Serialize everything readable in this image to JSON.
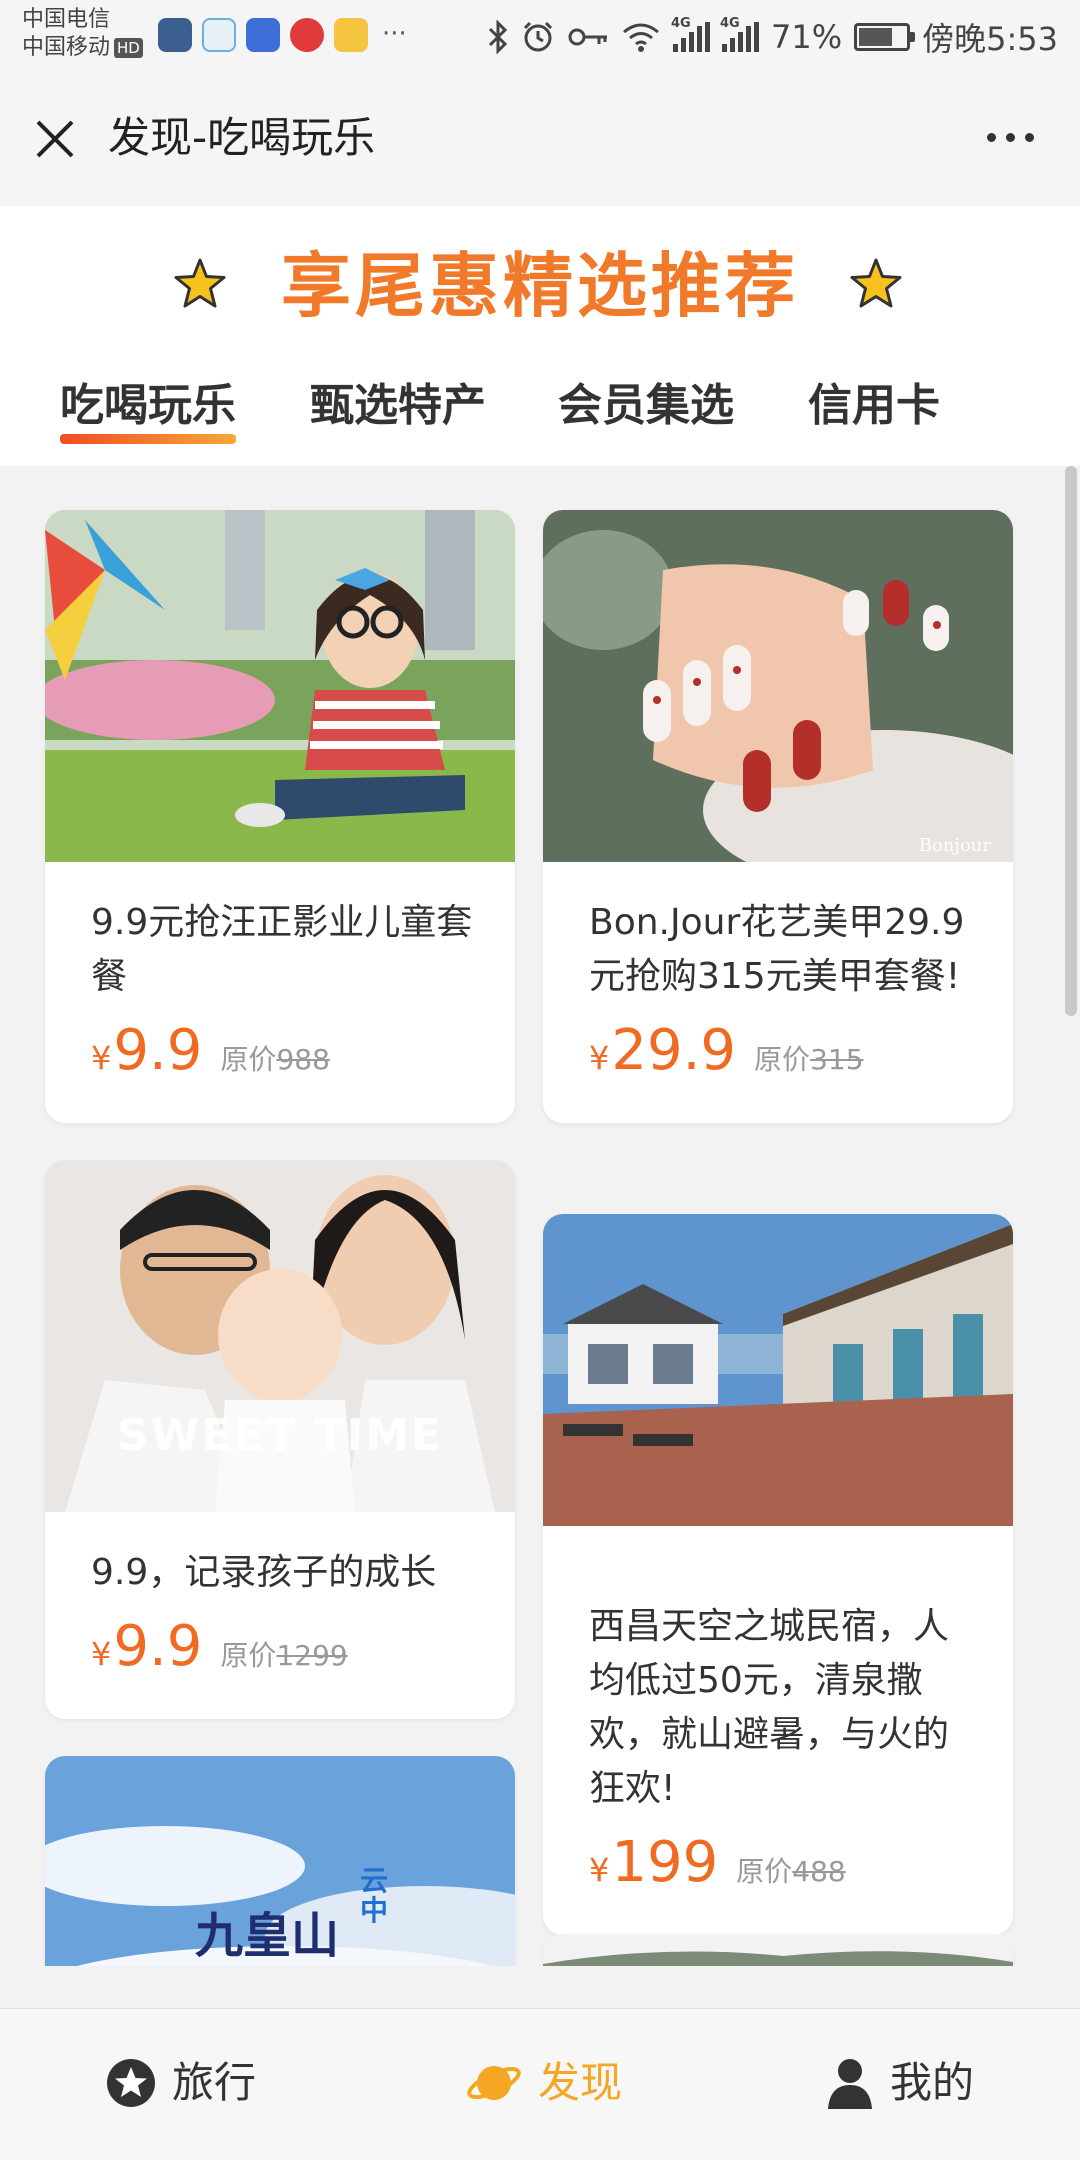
{
  "status_bar": {
    "carrier_1": "中国电信",
    "carrier_2": "中国移动",
    "hd": "HD",
    "more": "···",
    "net_1": "4G",
    "net_2": "4G",
    "battery_pct": "71%",
    "battery_level": 0.71,
    "time": "傍晚5:53"
  },
  "titlebar": {
    "title": "发现-吃喝玩乐"
  },
  "promo": {
    "title": "享尾惠精选推荐"
  },
  "tabs": [
    {
      "label": "吃喝玩乐",
      "active": true
    },
    {
      "label": "甄选特产",
      "active": false
    },
    {
      "label": "会员集选",
      "active": false
    },
    {
      "label": "信用卡",
      "active": false
    }
  ],
  "cards": [
    {
      "title": "9.9元抢汪正影业儿童套餐",
      "currency": "¥",
      "price": "9.9",
      "orig_label": "原价",
      "orig_price": "988"
    },
    {
      "title": "Bon.Jour花艺美甲29.9元抢购315元美甲套餐!",
      "image_text": "Bonjour",
      "currency": "¥",
      "price": "29.9",
      "orig_label": "原价",
      "orig_price": "315"
    },
    {
      "title": "9.9，记录孩子的成长",
      "image_text": "SWEET TIME",
      "currency": "¥",
      "price": "9.9",
      "orig_label": "原价",
      "orig_price": "1299"
    },
    {
      "title": "西昌天空之城民宿，人均低过50元，清泉撒欢，就山避暑，与火的狂欢!",
      "currency": "¥",
      "price": "199",
      "orig_label": "原价",
      "orig_price": "488"
    },
    {
      "image_text_1": "九皇山",
      "image_text_2": "云中"
    }
  ],
  "bottom_nav": [
    {
      "label": "旅行",
      "icon": "star-icon",
      "active": false
    },
    {
      "label": "发现",
      "icon": "planet-icon",
      "active": true
    },
    {
      "label": "我的",
      "icon": "user-icon",
      "active": false
    }
  ],
  "colors": {
    "accent": "#f07a2a",
    "price": "#f06a22",
    "nav_active": "#f5a623"
  }
}
